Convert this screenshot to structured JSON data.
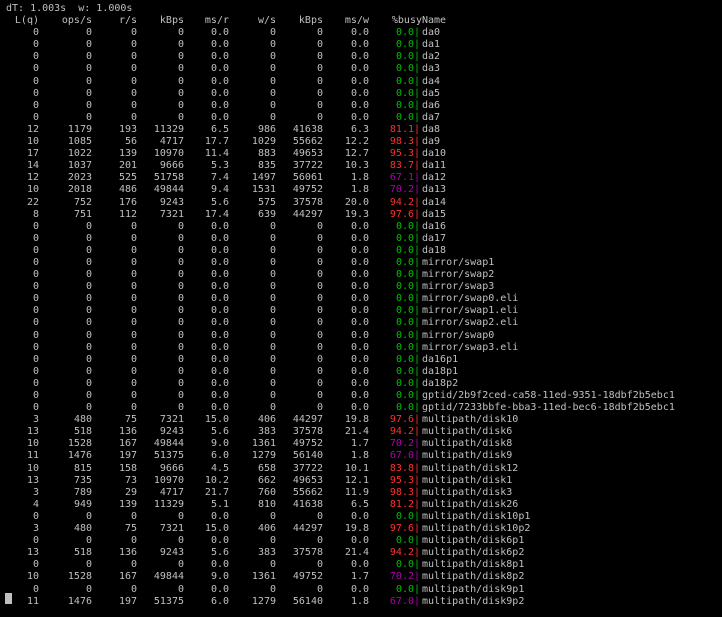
{
  "status_line": "dT: 1.003s  w: 1.000s",
  "headers": {
    "lq": "L(q)",
    "ops": "ops/s",
    "rs": "r/s",
    "kbr": "kBps",
    "msr": "ms/r",
    "ws": "w/s",
    "kbw": "kBps",
    "msw": "ms/w",
    "busy": "%busy",
    "name": "Name"
  },
  "colors": {
    "text": "#c0c0c0",
    "busy_low": "#00c000",
    "busy_mid": "#b000b0",
    "busy_high": "#ff3030"
  },
  "rows": [
    {
      "lq": "0",
      "ops": "0",
      "rs": "0",
      "kbr": "0",
      "msr": "0.0",
      "ws": "0",
      "kbw": "0",
      "msw": "0.0",
      "busy": "0.0",
      "name": "da0"
    },
    {
      "lq": "0",
      "ops": "0",
      "rs": "0",
      "kbr": "0",
      "msr": "0.0",
      "ws": "0",
      "kbw": "0",
      "msw": "0.0",
      "busy": "0.0",
      "name": "da1"
    },
    {
      "lq": "0",
      "ops": "0",
      "rs": "0",
      "kbr": "0",
      "msr": "0.0",
      "ws": "0",
      "kbw": "0",
      "msw": "0.0",
      "busy": "0.0",
      "name": "da2"
    },
    {
      "lq": "0",
      "ops": "0",
      "rs": "0",
      "kbr": "0",
      "msr": "0.0",
      "ws": "0",
      "kbw": "0",
      "msw": "0.0",
      "busy": "0.0",
      "name": "da3"
    },
    {
      "lq": "0",
      "ops": "0",
      "rs": "0",
      "kbr": "0",
      "msr": "0.0",
      "ws": "0",
      "kbw": "0",
      "msw": "0.0",
      "busy": "0.0",
      "name": "da4"
    },
    {
      "lq": "0",
      "ops": "0",
      "rs": "0",
      "kbr": "0",
      "msr": "0.0",
      "ws": "0",
      "kbw": "0",
      "msw": "0.0",
      "busy": "0.0",
      "name": "da5"
    },
    {
      "lq": "0",
      "ops": "0",
      "rs": "0",
      "kbr": "0",
      "msr": "0.0",
      "ws": "0",
      "kbw": "0",
      "msw": "0.0",
      "busy": "0.0",
      "name": "da6"
    },
    {
      "lq": "0",
      "ops": "0",
      "rs": "0",
      "kbr": "0",
      "msr": "0.0",
      "ws": "0",
      "kbw": "0",
      "msw": "0.0",
      "busy": "0.0",
      "name": "da7"
    },
    {
      "lq": "12",
      "ops": "1179",
      "rs": "193",
      "kbr": "11329",
      "msr": "6.5",
      "ws": "986",
      "kbw": "41638",
      "msw": "6.3",
      "busy": "81.1",
      "name": "da8"
    },
    {
      "lq": "10",
      "ops": "1085",
      "rs": "56",
      "kbr": "4717",
      "msr": "17.7",
      "ws": "1029",
      "kbw": "55662",
      "msw": "12.2",
      "busy": "98.3",
      "name": "da9"
    },
    {
      "lq": "17",
      "ops": "1022",
      "rs": "139",
      "kbr": "10970",
      "msr": "11.4",
      "ws": "883",
      "kbw": "49653",
      "msw": "12.7",
      "busy": "95.3",
      "name": "da10"
    },
    {
      "lq": "14",
      "ops": "1037",
      "rs": "201",
      "kbr": "9666",
      "msr": "5.3",
      "ws": "835",
      "kbw": "37722",
      "msw": "10.3",
      "busy": "83.7",
      "name": "da11"
    },
    {
      "lq": "12",
      "ops": "2023",
      "rs": "525",
      "kbr": "51758",
      "msr": "7.4",
      "ws": "1497",
      "kbw": "56061",
      "msw": "1.8",
      "busy": "67.1",
      "name": "da12"
    },
    {
      "lq": "10",
      "ops": "2018",
      "rs": "486",
      "kbr": "49844",
      "msr": "9.4",
      "ws": "1531",
      "kbw": "49752",
      "msw": "1.8",
      "busy": "70.2",
      "name": "da13"
    },
    {
      "lq": "22",
      "ops": "752",
      "rs": "176",
      "kbr": "9243",
      "msr": "5.6",
      "ws": "575",
      "kbw": "37578",
      "msw": "20.0",
      "busy": "94.2",
      "name": "da14"
    },
    {
      "lq": "8",
      "ops": "751",
      "rs": "112",
      "kbr": "7321",
      "msr": "17.4",
      "ws": "639",
      "kbw": "44297",
      "msw": "19.3",
      "busy": "97.6",
      "name": "da15"
    },
    {
      "lq": "0",
      "ops": "0",
      "rs": "0",
      "kbr": "0",
      "msr": "0.0",
      "ws": "0",
      "kbw": "0",
      "msw": "0.0",
      "busy": "0.0",
      "name": "da16"
    },
    {
      "lq": "0",
      "ops": "0",
      "rs": "0",
      "kbr": "0",
      "msr": "0.0",
      "ws": "0",
      "kbw": "0",
      "msw": "0.0",
      "busy": "0.0",
      "name": "da17"
    },
    {
      "lq": "0",
      "ops": "0",
      "rs": "0",
      "kbr": "0",
      "msr": "0.0",
      "ws": "0",
      "kbw": "0",
      "msw": "0.0",
      "busy": "0.0",
      "name": "da18"
    },
    {
      "lq": "0",
      "ops": "0",
      "rs": "0",
      "kbr": "0",
      "msr": "0.0",
      "ws": "0",
      "kbw": "0",
      "msw": "0.0",
      "busy": "0.0",
      "name": "mirror/swap1"
    },
    {
      "lq": "0",
      "ops": "0",
      "rs": "0",
      "kbr": "0",
      "msr": "0.0",
      "ws": "0",
      "kbw": "0",
      "msw": "0.0",
      "busy": "0.0",
      "name": "mirror/swap2"
    },
    {
      "lq": "0",
      "ops": "0",
      "rs": "0",
      "kbr": "0",
      "msr": "0.0",
      "ws": "0",
      "kbw": "0",
      "msw": "0.0",
      "busy": "0.0",
      "name": "mirror/swap3"
    },
    {
      "lq": "0",
      "ops": "0",
      "rs": "0",
      "kbr": "0",
      "msr": "0.0",
      "ws": "0",
      "kbw": "0",
      "msw": "0.0",
      "busy": "0.0",
      "name": "mirror/swap0.eli"
    },
    {
      "lq": "0",
      "ops": "0",
      "rs": "0",
      "kbr": "0",
      "msr": "0.0",
      "ws": "0",
      "kbw": "0",
      "msw": "0.0",
      "busy": "0.0",
      "name": "mirror/swap1.eli"
    },
    {
      "lq": "0",
      "ops": "0",
      "rs": "0",
      "kbr": "0",
      "msr": "0.0",
      "ws": "0",
      "kbw": "0",
      "msw": "0.0",
      "busy": "0.0",
      "name": "mirror/swap2.eli"
    },
    {
      "lq": "0",
      "ops": "0",
      "rs": "0",
      "kbr": "0",
      "msr": "0.0",
      "ws": "0",
      "kbw": "0",
      "msw": "0.0",
      "busy": "0.0",
      "name": "mirror/swap0"
    },
    {
      "lq": "0",
      "ops": "0",
      "rs": "0",
      "kbr": "0",
      "msr": "0.0",
      "ws": "0",
      "kbw": "0",
      "msw": "0.0",
      "busy": "0.0",
      "name": "mirror/swap3.eli"
    },
    {
      "lq": "0",
      "ops": "0",
      "rs": "0",
      "kbr": "0",
      "msr": "0.0",
      "ws": "0",
      "kbw": "0",
      "msw": "0.0",
      "busy": "0.0",
      "name": "da16p1"
    },
    {
      "lq": "0",
      "ops": "0",
      "rs": "0",
      "kbr": "0",
      "msr": "0.0",
      "ws": "0",
      "kbw": "0",
      "msw": "0.0",
      "busy": "0.0",
      "name": "da18p1"
    },
    {
      "lq": "0",
      "ops": "0",
      "rs": "0",
      "kbr": "0",
      "msr": "0.0",
      "ws": "0",
      "kbw": "0",
      "msw": "0.0",
      "busy": "0.0",
      "name": "da18p2"
    },
    {
      "lq": "0",
      "ops": "0",
      "rs": "0",
      "kbr": "0",
      "msr": "0.0",
      "ws": "0",
      "kbw": "0",
      "msw": "0.0",
      "busy": "0.0",
      "name": "gptid/2b9f2ced-ca58-11ed-9351-18dbf2b5ebc1"
    },
    {
      "lq": "0",
      "ops": "0",
      "rs": "0",
      "kbr": "0",
      "msr": "0.0",
      "ws": "0",
      "kbw": "0",
      "msw": "0.0",
      "busy": "0.0",
      "name": "gptid/7233bbfe-bba3-11ed-bec6-18dbf2b5ebc1"
    },
    {
      "lq": "3",
      "ops": "480",
      "rs": "75",
      "kbr": "7321",
      "msr": "15.0",
      "ws": "406",
      "kbw": "44297",
      "msw": "19.8",
      "busy": "97.6",
      "name": "multipath/disk10"
    },
    {
      "lq": "13",
      "ops": "518",
      "rs": "136",
      "kbr": "9243",
      "msr": "5.6",
      "ws": "383",
      "kbw": "37578",
      "msw": "21.4",
      "busy": "94.2",
      "name": "multipath/disk6"
    },
    {
      "lq": "10",
      "ops": "1528",
      "rs": "167",
      "kbr": "49844",
      "msr": "9.0",
      "ws": "1361",
      "kbw": "49752",
      "msw": "1.7",
      "busy": "70.2",
      "name": "multipath/disk8"
    },
    {
      "lq": "11",
      "ops": "1476",
      "rs": "197",
      "kbr": "51375",
      "msr": "6.0",
      "ws": "1279",
      "kbw": "56140",
      "msw": "1.8",
      "busy": "67.0",
      "name": "multipath/disk9"
    },
    {
      "lq": "10",
      "ops": "815",
      "rs": "158",
      "kbr": "9666",
      "msr": "4.5",
      "ws": "658",
      "kbw": "37722",
      "msw": "10.1",
      "busy": "83.8",
      "name": "multipath/disk12"
    },
    {
      "lq": "13",
      "ops": "735",
      "rs": "73",
      "kbr": "10970",
      "msr": "10.2",
      "ws": "662",
      "kbw": "49653",
      "msw": "12.1",
      "busy": "95.3",
      "name": "multipath/disk1"
    },
    {
      "lq": "3",
      "ops": "789",
      "rs": "29",
      "kbr": "4717",
      "msr": "21.7",
      "ws": "760",
      "kbw": "55662",
      "msw": "11.9",
      "busy": "98.3",
      "name": "multipath/disk3"
    },
    {
      "lq": "4",
      "ops": "949",
      "rs": "139",
      "kbr": "11329",
      "msr": "5.1",
      "ws": "810",
      "kbw": "41638",
      "msw": "6.5",
      "busy": "81.2",
      "name": "multipath/disk26"
    },
    {
      "lq": "0",
      "ops": "0",
      "rs": "0",
      "kbr": "0",
      "msr": "0.0",
      "ws": "0",
      "kbw": "0",
      "msw": "0.0",
      "busy": "0.0",
      "name": "multipath/disk10p1"
    },
    {
      "lq": "3",
      "ops": "480",
      "rs": "75",
      "kbr": "7321",
      "msr": "15.0",
      "ws": "406",
      "kbw": "44297",
      "msw": "19.8",
      "busy": "97.6",
      "name": "multipath/disk10p2"
    },
    {
      "lq": "0",
      "ops": "0",
      "rs": "0",
      "kbr": "0",
      "msr": "0.0",
      "ws": "0",
      "kbw": "0",
      "msw": "0.0",
      "busy": "0.0",
      "name": "multipath/disk6p1"
    },
    {
      "lq": "13",
      "ops": "518",
      "rs": "136",
      "kbr": "9243",
      "msr": "5.6",
      "ws": "383",
      "kbw": "37578",
      "msw": "21.4",
      "busy": "94.2",
      "name": "multipath/disk6p2"
    },
    {
      "lq": "0",
      "ops": "0",
      "rs": "0",
      "kbr": "0",
      "msr": "0.0",
      "ws": "0",
      "kbw": "0",
      "msw": "0.0",
      "busy": "0.0",
      "name": "multipath/disk8p1"
    },
    {
      "lq": "10",
      "ops": "1528",
      "rs": "167",
      "kbr": "49844",
      "msr": "9.0",
      "ws": "1361",
      "kbw": "49752",
      "msw": "1.7",
      "busy": "70.2",
      "name": "multipath/disk8p2"
    },
    {
      "lq": "0",
      "ops": "0",
      "rs": "0",
      "kbr": "0",
      "msr": "0.0",
      "ws": "0",
      "kbw": "0",
      "msw": "0.0",
      "busy": "0.0",
      "name": "multipath/disk9p1"
    },
    {
      "lq": "11",
      "ops": "1476",
      "rs": "197",
      "kbr": "51375",
      "msr": "6.0",
      "ws": "1279",
      "kbw": "56140",
      "msw": "1.8",
      "busy": "67.0",
      "name": "multipath/disk9p2"
    }
  ]
}
